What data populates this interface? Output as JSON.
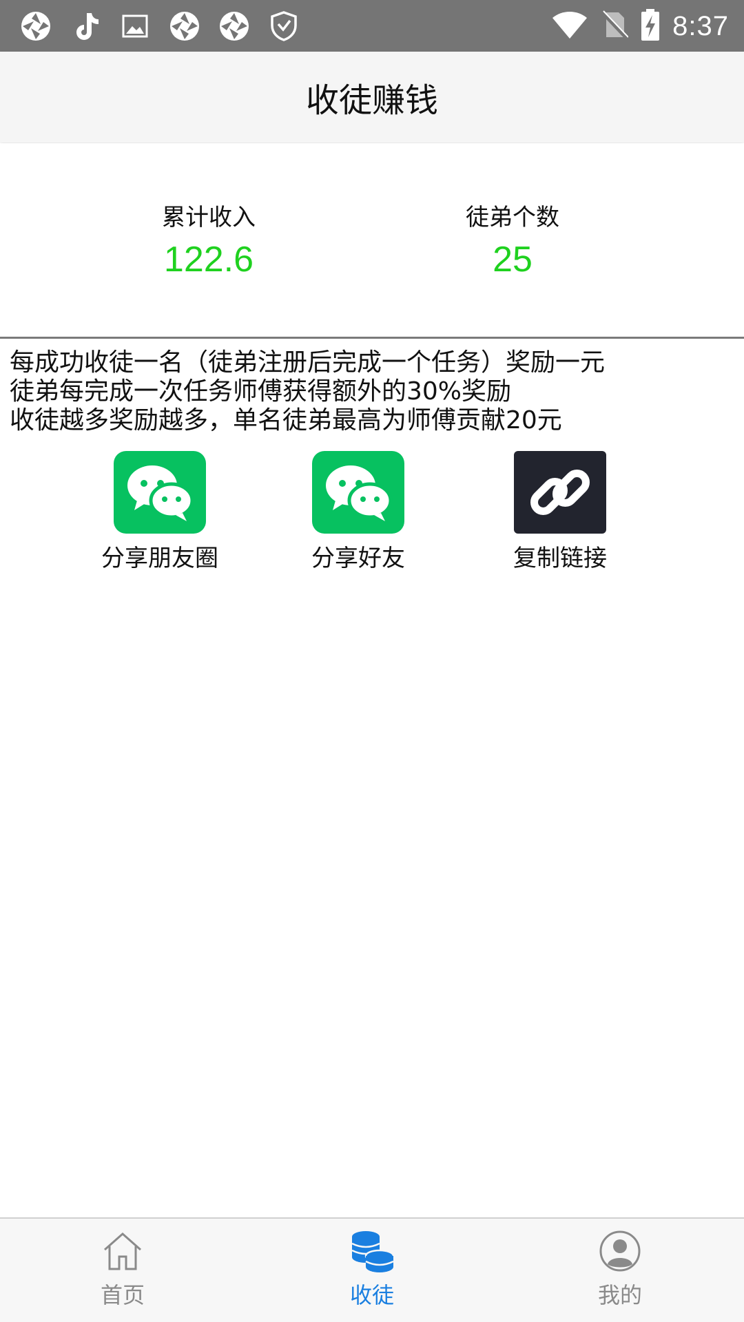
{
  "status_bar": {
    "time": "8:37",
    "left_icons": [
      "aperture-icon",
      "tiktok-icon",
      "image-icon",
      "aperture-icon",
      "aperture-icon",
      "shield-check-icon"
    ],
    "right_icons": [
      "wifi-icon",
      "no-sim-icon",
      "battery-charging-icon"
    ]
  },
  "header": {
    "title": "收徒赚钱"
  },
  "stats": {
    "income_label": "累计收入",
    "income_value": "122.6",
    "disciples_label": "徒弟个数",
    "disciples_value": "25",
    "value_color": "#1fd11f"
  },
  "rules": [
    "每成功收徒一名（徒弟注册后完成一个任务）奖励一元",
    "徒弟每完成一次任务师傅获得额外的30%奖励",
    "收徒越多奖励越多，单名徒弟最高为师傅贡献20元"
  ],
  "share": {
    "moments_label": "分享朋友圈",
    "friends_label": "分享好友",
    "copy_link_label": "复制链接",
    "wechat_color": "#07c160",
    "link_bg_color": "#22242e"
  },
  "bottom_nav": {
    "home_label": "首页",
    "recruit_label": "收徒",
    "mine_label": "我的",
    "active_color": "#1a7fe0",
    "inactive_color": "#8a8a8a"
  }
}
